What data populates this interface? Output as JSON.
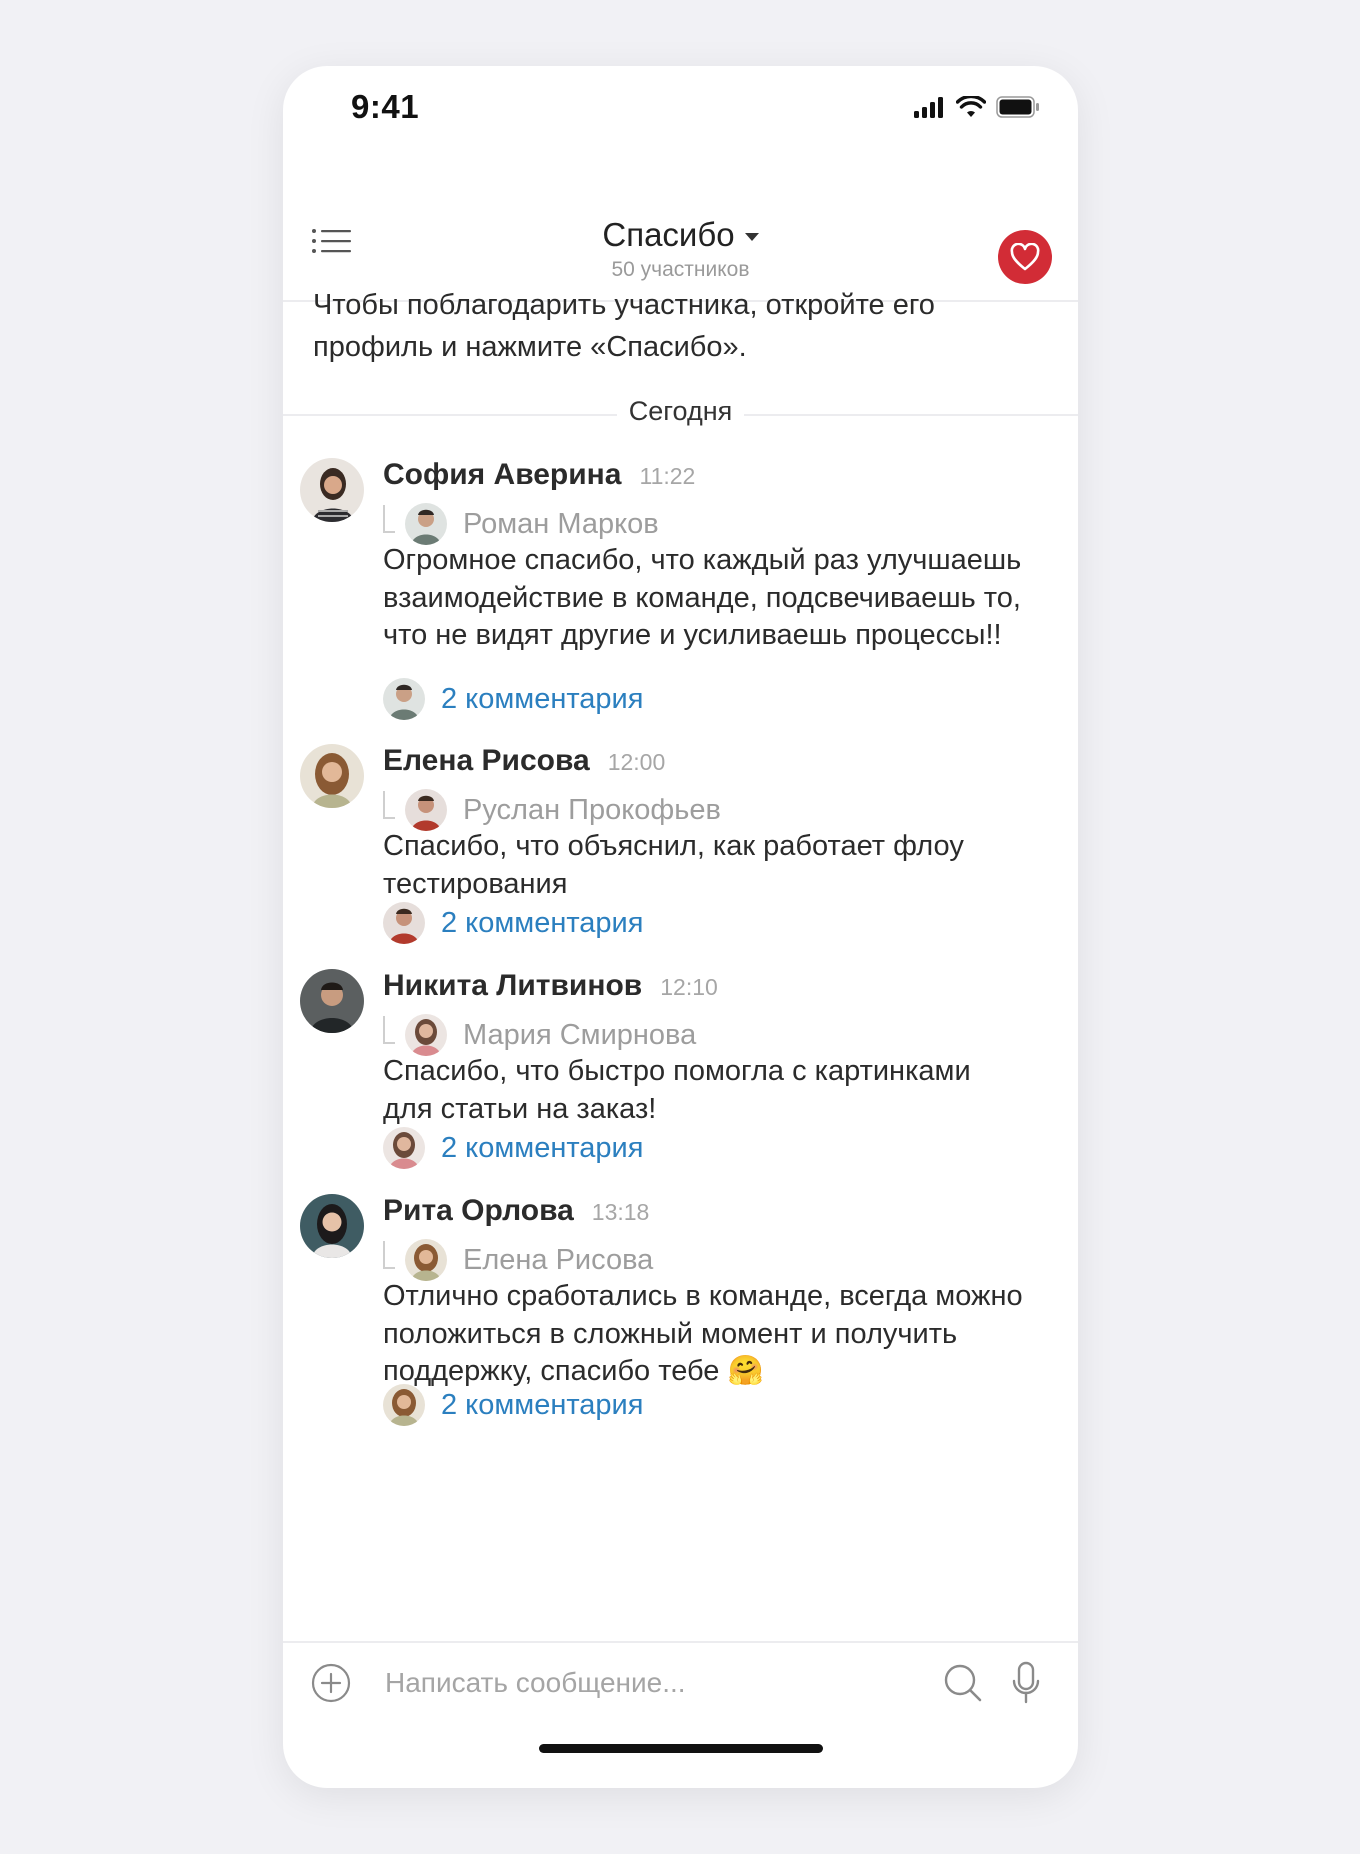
{
  "status_bar": {
    "time": "9:41"
  },
  "header": {
    "title": "Спасибо",
    "subtitle": "50 участников",
    "icons": {
      "menu": "list-icon",
      "dropdown": "caret-down-icon",
      "action": "heart-icon"
    },
    "accent_color": "#d22c36"
  },
  "info_text": "Чтобы поблагодарить участника, откройте его профиль и нажмите «Спасибо».",
  "date_separator": "Сегодня",
  "messages": [
    {
      "author": "София Аверина",
      "time": "11:22",
      "recipient": "Роман Марков",
      "text": "Огромное спасибо, что каждый раз улучшаешь взаимодействие в команде, подсвечиваешь то, что не видят другие и усиливаешь процессы!!",
      "comments": "2 комментария"
    },
    {
      "author": "Елена Рисова",
      "time": "12:00",
      "recipient": "Руслан Прокофьев",
      "text": "Спасибо, что объяснил, как работает флоу тестирования",
      "comments": "2 комментария"
    },
    {
      "author": "Никита Литвинов",
      "time": "12:10",
      "recipient": "Мария Смирнова",
      "text": "Спасибо, что быстро помогла с картинками для статьи на заказ!",
      "comments": "2 комментария"
    },
    {
      "author": "Рита Орлова",
      "time": "13:18",
      "recipient": "Елена Рисова",
      "text": "Отлично сработались в команде, всегда можно положиться в сложный момент и получить поддержку, спасибо тебе 🤗",
      "comments": "2 комментария"
    }
  ],
  "composer": {
    "placeholder": "Написать сообщение..."
  },
  "colors": {
    "link": "#2b7fbf",
    "muted": "#9d9d9d",
    "background": "#f1f1f5"
  }
}
